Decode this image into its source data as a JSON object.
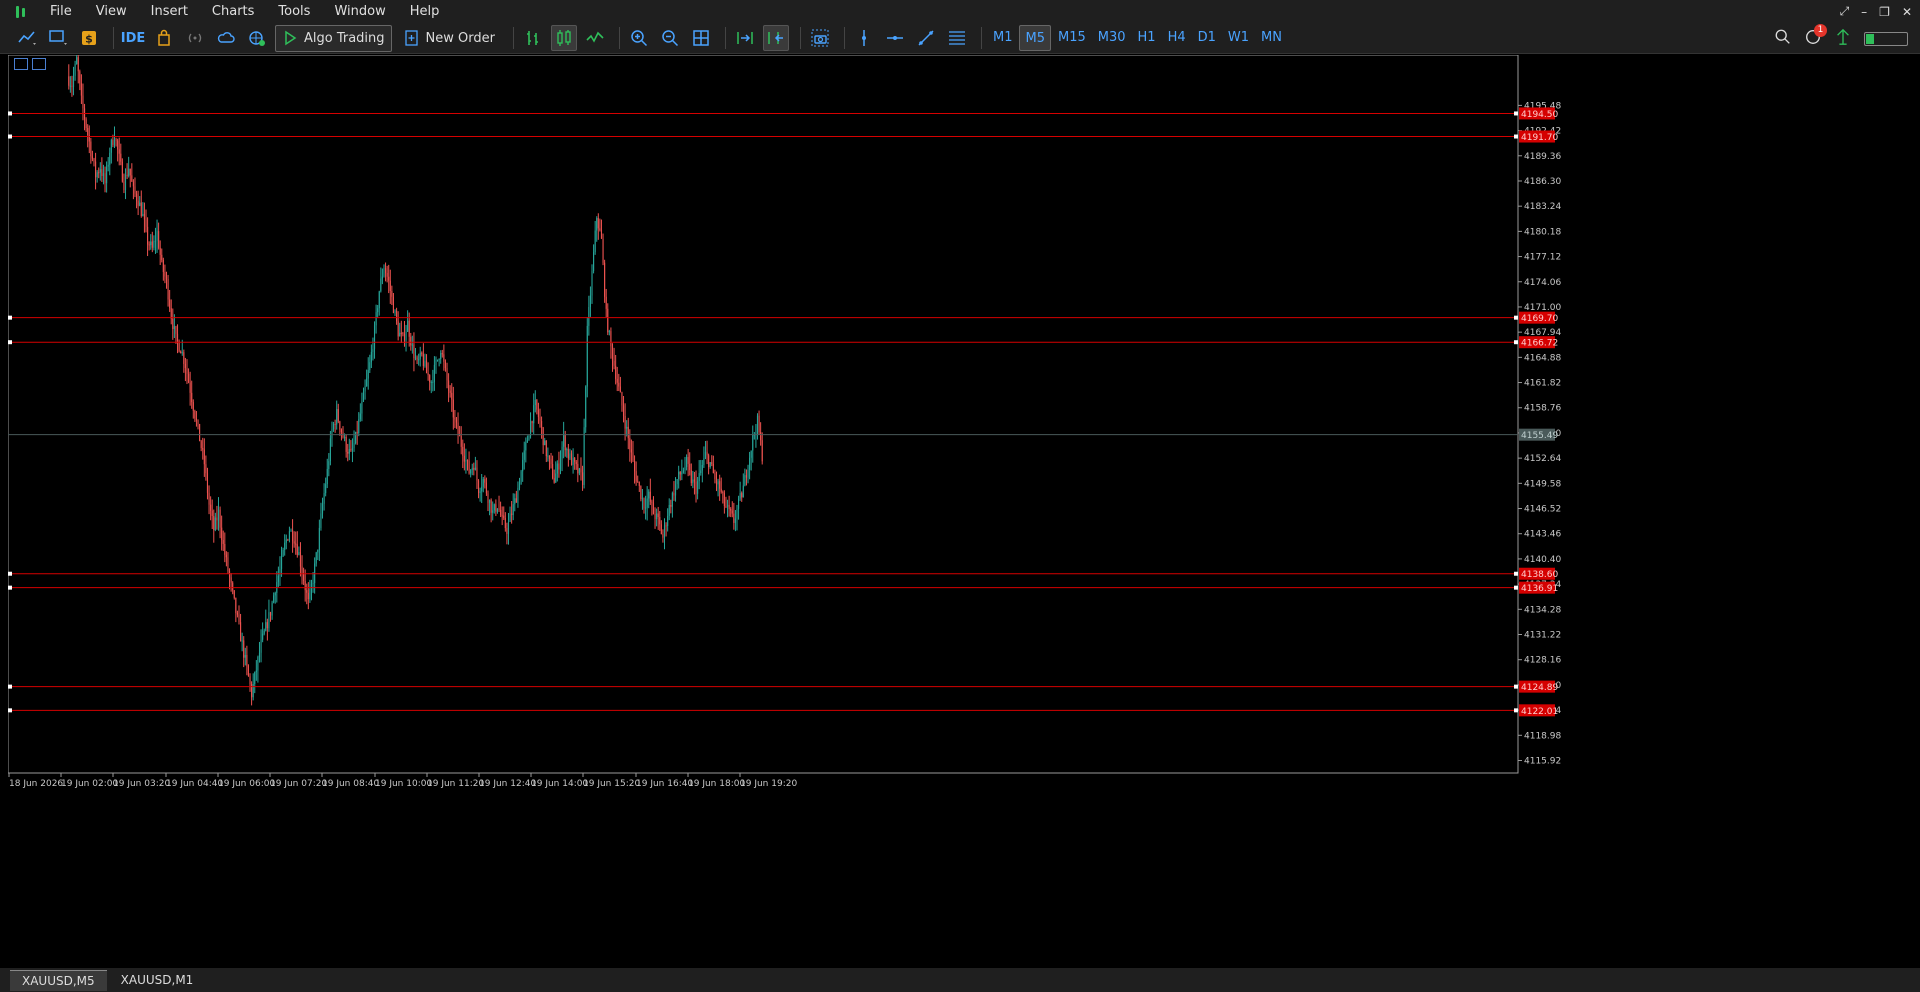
{
  "menu": [
    "File",
    "View",
    "Insert",
    "Charts",
    "Tools",
    "Window",
    "Help"
  ],
  "toolbar": {
    "ide_label": "IDE",
    "algo_trading_label": "Algo Trading",
    "new_order_label": "New Order",
    "timeframes": [
      "M1",
      "M5",
      "M15",
      "M30",
      "H1",
      "H4",
      "D1",
      "W1",
      "MN"
    ],
    "active_timeframe": "M5",
    "notification_count": "1",
    "signal_level": 0.2
  },
  "tabs": [
    {
      "label": "XAUUSD,M5",
      "active": true
    },
    {
      "label": "XAUUSD,M1",
      "active": false
    }
  ],
  "colors": {
    "bull": "#26a69a",
    "bear": "#ef5350",
    "hline": "#d50000",
    "bid": "#4a5a5a",
    "grid_text": "#c8c8c8",
    "active_tf": "#4aa3ff"
  },
  "chart_data": {
    "type": "candlestick",
    "symbol": "XAUUSD",
    "timeframe": "M5",
    "ylim": [
      4114.4,
      4201.6
    ],
    "y_ticks": [
      "4195.48",
      "4192.42",
      "4189.36",
      "4186.30",
      "4183.24",
      "4180.18",
      "4177.12",
      "4174.06",
      "4171.00",
      "4167.94",
      "4164.88",
      "4161.82",
      "4158.76",
      "4155.70",
      "4152.64",
      "4149.58",
      "4146.52",
      "4143.46",
      "4140.40",
      "4137.34",
      "4134.28",
      "4131.22",
      "4128.16",
      "4125.10",
      "4122.04",
      "4118.98",
      "4115.92"
    ],
    "x_ticks": [
      "18 Jun 2026",
      "19 Jun 02:00",
      "19 Jun 03:20",
      "19 Jun 04:40",
      "19 Jun 06:00",
      "19 Jun 07:20",
      "19 Jun 08:40",
      "19 Jun 10:00",
      "19 Jun 11:20",
      "19 Jun 12:40",
      "19 Jun 14:00",
      "19 Jun 15:20",
      "19 Jun 16:40",
      "19 Jun 18:00",
      "19 Jun 19:20"
    ],
    "hlines": [
      {
        "price": 4194.5,
        "label": "4194.50"
      },
      {
        "price": 4191.7,
        "label": "4191.70"
      },
      {
        "price": 4169.7,
        "label": "4169.70"
      },
      {
        "price": 4166.72,
        "label": "4166.72"
      },
      {
        "price": 4138.6,
        "label": "4138.60"
      },
      {
        "price": 4136.91,
        "label": "4136.91"
      },
      {
        "price": 4124.89,
        "label": "4124.89"
      },
      {
        "price": 4122.01,
        "label": "4122.01"
      }
    ],
    "bid": {
      "price": 4155.49,
      "label": "4155.49"
    },
    "path": [
      4199,
      4198,
      4201,
      4196,
      4193,
      4190,
      4187,
      4188,
      4186,
      4190,
      4192,
      4189,
      4186,
      4188,
      4185,
      4184,
      4182,
      4179,
      4178,
      4180,
      4176,
      4174,
      4170,
      4167,
      4166,
      4164,
      4161,
      4158,
      4155,
      4152,
      4147,
      4144,
      4146,
      4142,
      4139,
      4136,
      4133,
      4130,
      4127,
      4124,
      4127,
      4130,
      4132,
      4134,
      4137,
      4139,
      4142,
      4144,
      4143,
      4141,
      4138,
      4135,
      4138,
      4142,
      4147,
      4151,
      4156,
      4158,
      4156,
      4154,
      4153,
      4155,
      4158,
      4161,
      4164,
      4168,
      4173,
      4176,
      4174,
      4171,
      4168,
      4167,
      4169,
      4166,
      4164,
      4165,
      4163,
      4162,
      4164,
      4166,
      4163,
      4160,
      4157,
      4155,
      4153,
      4151,
      4152,
      4149,
      4150,
      4148,
      4146,
      4147,
      4145,
      4144,
      4146,
      4148,
      4151,
      4154,
      4157,
      4159,
      4157,
      4154,
      4152,
      4150,
      4152,
      4155,
      4153,
      4152,
      4151,
      4150,
      4168,
      4175,
      4182,
      4179,
      4170,
      4166,
      4163,
      4160,
      4157,
      4154,
      4151,
      4149,
      4147,
      4148,
      4146,
      4145,
      4143,
      4146,
      4148,
      4150,
      4151,
      4152,
      4150,
      4149,
      4151,
      4153,
      4152,
      4150,
      4149,
      4147,
      4146,
      4145,
      4147,
      4149,
      4152,
      4155,
      4157,
      4153
    ]
  }
}
